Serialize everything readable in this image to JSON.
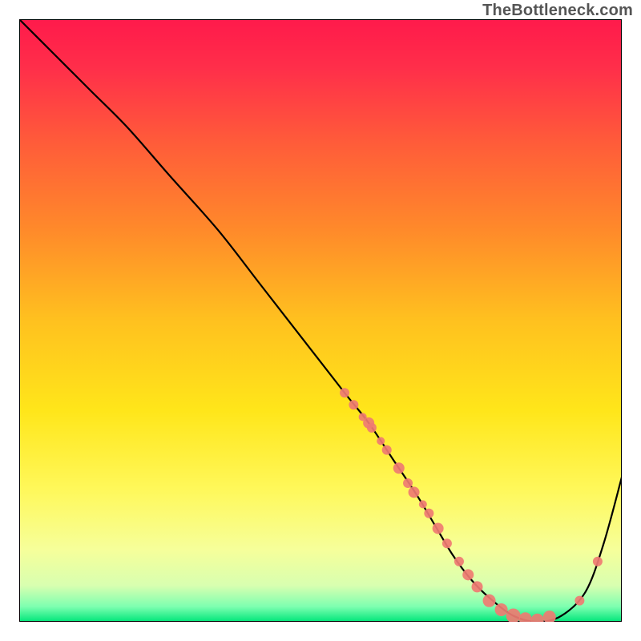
{
  "watermark": "TheBottleneck.com",
  "chart_data": {
    "type": "line",
    "title": "",
    "xlabel": "",
    "ylabel": "",
    "xlim": [
      0,
      100
    ],
    "ylim": [
      0,
      100
    ],
    "background_gradient": {
      "stops": [
        {
          "offset": 0.0,
          "color": "#ff1a4b"
        },
        {
          "offset": 0.08,
          "color": "#ff2e4a"
        },
        {
          "offset": 0.2,
          "color": "#ff5a3a"
        },
        {
          "offset": 0.35,
          "color": "#ff8a2a"
        },
        {
          "offset": 0.5,
          "color": "#ffc11f"
        },
        {
          "offset": 0.65,
          "color": "#ffe61a"
        },
        {
          "offset": 0.78,
          "color": "#fff85a"
        },
        {
          "offset": 0.88,
          "color": "#f6ff9a"
        },
        {
          "offset": 0.94,
          "color": "#d8ffb0"
        },
        {
          "offset": 0.975,
          "color": "#7dffb0"
        },
        {
          "offset": 1.0,
          "color": "#00e67a"
        }
      ]
    },
    "series": [
      {
        "name": "bottleneck-curve",
        "color": "#000000",
        "x": [
          0,
          4,
          8,
          12,
          18,
          25,
          33,
          40,
          47,
          54,
          58,
          62,
          66,
          69,
          72,
          75,
          78,
          82,
          86,
          90,
          94,
          97,
          100
        ],
        "y": [
          100,
          96,
          92,
          88,
          82,
          74,
          65,
          56,
          47,
          38,
          33,
          27,
          21,
          16,
          11,
          7,
          4,
          1,
          0,
          1,
          5,
          13,
          24
        ]
      }
    ],
    "markers": {
      "name": "highlight-points",
      "color": "#ef7b72",
      "points": [
        {
          "x": 54.0,
          "y": 38.0,
          "r": 6
        },
        {
          "x": 55.5,
          "y": 36.0,
          "r": 6
        },
        {
          "x": 57.0,
          "y": 34.0,
          "r": 5
        },
        {
          "x": 58.0,
          "y": 33.0,
          "r": 7
        },
        {
          "x": 58.5,
          "y": 32.2,
          "r": 6
        },
        {
          "x": 60.0,
          "y": 30.0,
          "r": 5
        },
        {
          "x": 61.0,
          "y": 28.5,
          "r": 6
        },
        {
          "x": 63.0,
          "y": 25.5,
          "r": 7
        },
        {
          "x": 64.5,
          "y": 23.0,
          "r": 6
        },
        {
          "x": 65.5,
          "y": 21.5,
          "r": 7
        },
        {
          "x": 67.0,
          "y": 19.5,
          "r": 5
        },
        {
          "x": 68.0,
          "y": 18.0,
          "r": 6
        },
        {
          "x": 69.5,
          "y": 15.5,
          "r": 7
        },
        {
          "x": 71.0,
          "y": 13.0,
          "r": 6
        },
        {
          "x": 73.0,
          "y": 10.0,
          "r": 6
        },
        {
          "x": 74.5,
          "y": 7.8,
          "r": 7
        },
        {
          "x": 76.0,
          "y": 5.8,
          "r": 7
        },
        {
          "x": 78.0,
          "y": 3.5,
          "r": 8
        },
        {
          "x": 80.0,
          "y": 2.0,
          "r": 8
        },
        {
          "x": 82.0,
          "y": 1.0,
          "r": 9
        },
        {
          "x": 84.0,
          "y": 0.5,
          "r": 8
        },
        {
          "x": 86.0,
          "y": 0.3,
          "r": 8
        },
        {
          "x": 88.0,
          "y": 0.8,
          "r": 8
        },
        {
          "x": 93.0,
          "y": 3.5,
          "r": 6
        },
        {
          "x": 96.0,
          "y": 10.0,
          "r": 6
        }
      ]
    }
  }
}
